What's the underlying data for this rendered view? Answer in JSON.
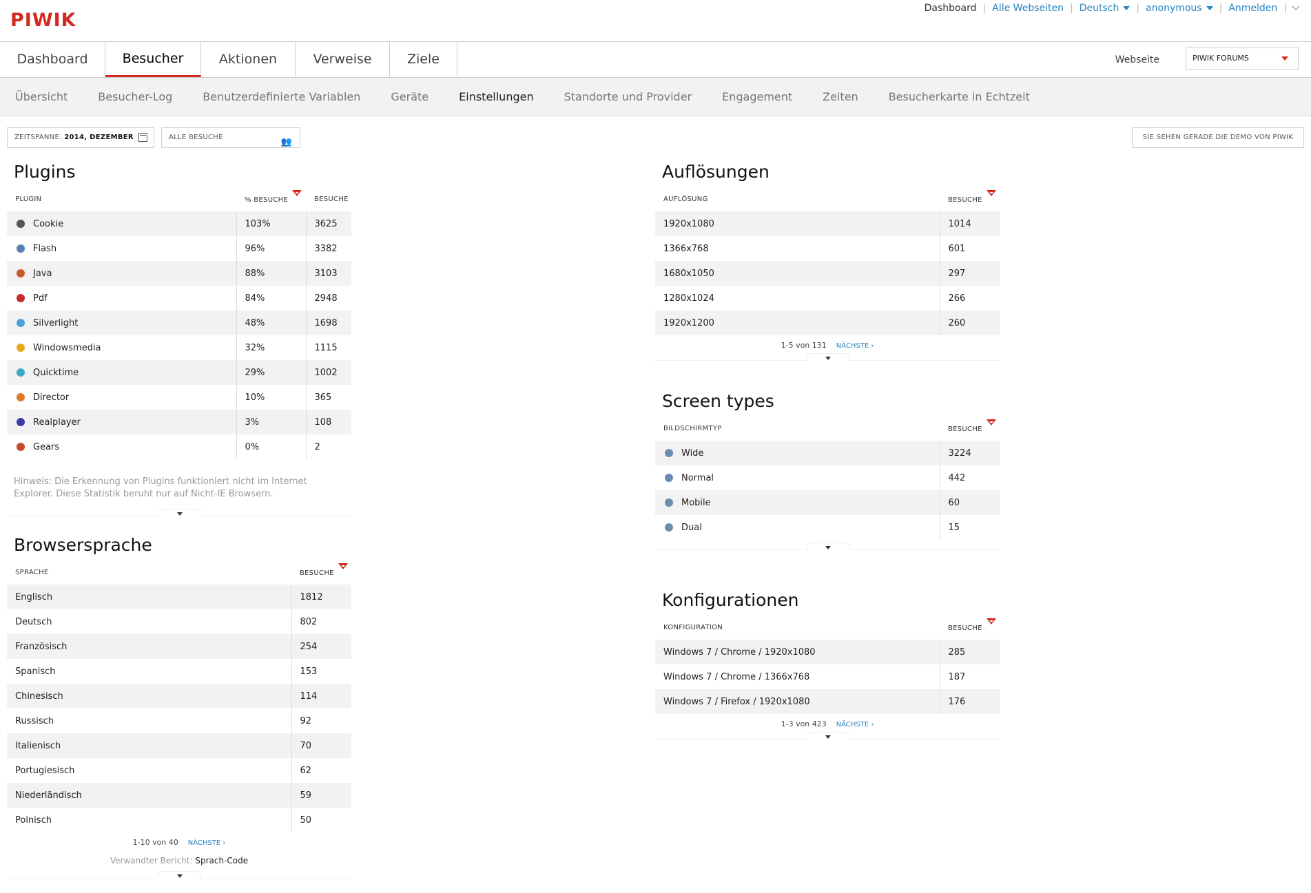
{
  "logo": "PIWIK",
  "topmenu": {
    "items": [
      {
        "label": "Dashboard",
        "current": true
      },
      {
        "label": "Alle Webseiten"
      },
      {
        "label": "Deutsch"
      },
      {
        "label": "anonymous"
      },
      {
        "label": "Anmelden"
      }
    ]
  },
  "mainnav": {
    "tabs": [
      "Dashboard",
      "Besucher",
      "Aktionen",
      "Verweise",
      "Ziele"
    ],
    "active": "Besucher"
  },
  "site_selector": {
    "label": "Webseite",
    "value": "PIWIK FORUMS"
  },
  "subnav": {
    "items": [
      "Übersicht",
      "Besucher-Log",
      "Benutzerdefinierte Variablen",
      "Geräte",
      "Einstellungen",
      "Standorte und Provider",
      "Engagement",
      "Zeiten",
      "Besucherkarte in Echtzeit"
    ],
    "active": "Einstellungen"
  },
  "controls": {
    "period_label": "ZEITSPANNE:",
    "period_value": "2014, DEZEMBER",
    "segment": "ALLE BESUCHE",
    "demo": "SIE SEHEN GERADE DIE DEMO VON PIWIK"
  },
  "plugins": {
    "title": "Plugins",
    "col_label": "PLUGIN",
    "col_pct": "% BESUCHE",
    "col_visits": "BESUCHE",
    "rows": [
      {
        "name": "Cookie",
        "pct": "103%",
        "visits": "3625",
        "icon": "cookie-icon",
        "color": "#555555"
      },
      {
        "name": "Flash",
        "pct": "96%",
        "visits": "3382",
        "icon": "flash-icon",
        "color": "#5a7fb5"
      },
      {
        "name": "Java",
        "pct": "88%",
        "visits": "3103",
        "icon": "java-icon",
        "color": "#c55a2a"
      },
      {
        "name": "Pdf",
        "pct": "84%",
        "visits": "2948",
        "icon": "pdf-icon",
        "color": "#c8282e"
      },
      {
        "name": "Silverlight",
        "pct": "48%",
        "visits": "1698",
        "icon": "silverlight-icon",
        "color": "#4aa3df"
      },
      {
        "name": "Windowsmedia",
        "pct": "32%",
        "visits": "1115",
        "icon": "windowsmedia-icon",
        "color": "#e8a81a"
      },
      {
        "name": "Quicktime",
        "pct": "29%",
        "visits": "1002",
        "icon": "quicktime-icon",
        "color": "#3fa9c9"
      },
      {
        "name": "Director",
        "pct": "10%",
        "visits": "365",
        "icon": "director-icon",
        "color": "#e07a2b"
      },
      {
        "name": "Realplayer",
        "pct": "3%",
        "visits": "108",
        "icon": "realplayer-icon",
        "color": "#3a3fa8"
      },
      {
        "name": "Gears",
        "pct": "0%",
        "visits": "2",
        "icon": "gears-icon",
        "color": "#c44a2a"
      }
    ],
    "note": "Hinweis: Die Erkennung von Plugins funktioniert nicht im Internet Explorer. Diese Statistik beruht nur auf Nicht-IE Browsern."
  },
  "browsersprache": {
    "title": "Browsersprache",
    "col_label": "SPRACHE",
    "col_visits": "BESUCHE",
    "rows": [
      {
        "name": "Englisch",
        "visits": "1812"
      },
      {
        "name": "Deutsch",
        "visits": "802"
      },
      {
        "name": "Französisch",
        "visits": "254"
      },
      {
        "name": "Spanisch",
        "visits": "153"
      },
      {
        "name": "Chinesisch",
        "visits": "114"
      },
      {
        "name": "Russisch",
        "visits": "92"
      },
      {
        "name": "Italienisch",
        "visits": "70"
      },
      {
        "name": "Portugiesisch",
        "visits": "62"
      },
      {
        "name": "Niederländisch",
        "visits": "59"
      },
      {
        "name": "Polnisch",
        "visits": "50"
      }
    ],
    "pager": "1-10 von 40",
    "next": "NÄCHSTE ›",
    "related_label": "Verwandter Bericht:",
    "related_value": "Sprach-Code"
  },
  "aufloesungen": {
    "title": "Auflösungen",
    "col_label": "AUFLÖSUNG",
    "col_visits": "BESUCHE",
    "rows": [
      {
        "name": "1920x1080",
        "visits": "1014"
      },
      {
        "name": "1366x768",
        "visits": "601"
      },
      {
        "name": "1680x1050",
        "visits": "297"
      },
      {
        "name": "1280x1024",
        "visits": "266"
      },
      {
        "name": "1920x1200",
        "visits": "260"
      }
    ],
    "pager": "1-5 von 131",
    "next": "NÄCHSTE ›"
  },
  "screentypes": {
    "title": "Screen types",
    "col_label": "BILDSCHIRMTYP",
    "col_visits": "BESUCHE",
    "rows": [
      {
        "name": "Wide",
        "visits": "3224",
        "icon": "wide-screen-icon",
        "color": "#6a8cb0"
      },
      {
        "name": "Normal",
        "visits": "442",
        "icon": "normal-screen-icon",
        "color": "#6a8cb0"
      },
      {
        "name": "Mobile",
        "visits": "60",
        "icon": "mobile-icon",
        "color": "#6a8cb0"
      },
      {
        "name": "Dual",
        "visits": "15",
        "icon": "dual-screen-icon",
        "color": "#6a8cb0"
      }
    ]
  },
  "konfigurationen": {
    "title": "Konfigurationen",
    "col_label": "KONFIGURATION",
    "col_visits": "BESUCHE",
    "rows": [
      {
        "name": "Windows 7 / Chrome / 1920x1080",
        "visits": "285"
      },
      {
        "name": "Windows 7 / Chrome / 1366x768",
        "visits": "187"
      },
      {
        "name": "Windows 7 / Firefox / 1920x1080",
        "visits": "176"
      }
    ],
    "pager": "1-3 von 423",
    "next": "NÄCHSTE ›"
  }
}
